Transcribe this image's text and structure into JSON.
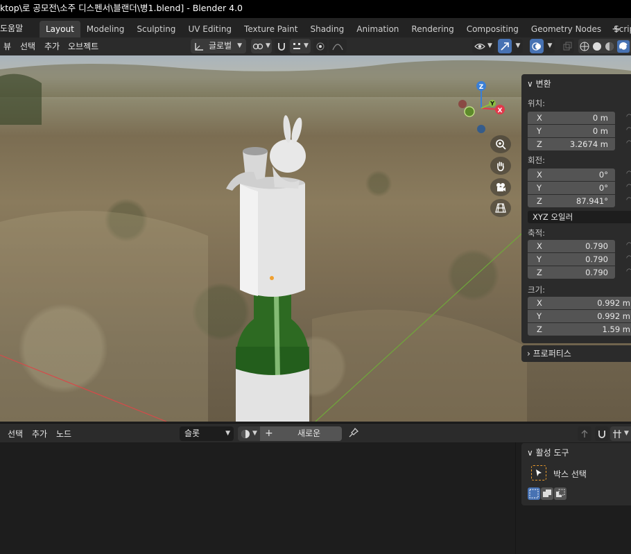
{
  "window": {
    "title": "ktop\\로 공모전\\소주 디스펜서\\블랜더\\병1.blend] - Blender 4.0"
  },
  "menu": {
    "help": "도움말"
  },
  "workspaces": [
    {
      "label": "Layout",
      "active": true
    },
    {
      "label": "Modeling"
    },
    {
      "label": "Sculpting"
    },
    {
      "label": "UV Editing"
    },
    {
      "label": "Texture Paint"
    },
    {
      "label": "Shading"
    },
    {
      "label": "Animation"
    },
    {
      "label": "Rendering"
    },
    {
      "label": "Compositing"
    },
    {
      "label": "Geometry Nodes"
    },
    {
      "label": "Scripting"
    }
  ],
  "workspace_add": "+",
  "viewport_header": {
    "view": "뷰",
    "select": "선택",
    "add": "추가",
    "object": "오브젝트",
    "transform_orientation": "글로벌"
  },
  "transform_panel": {
    "title": "변환",
    "location_label": "위치:",
    "location": {
      "x": "0 m",
      "y": "0 m",
      "z": "3.2674 m"
    },
    "rotation_label": "회전:",
    "rotation": {
      "x": "0°",
      "y": "0°",
      "z": "87.941°"
    },
    "rotation_mode": "XYZ 오일러",
    "scale_label": "축적:",
    "scale": {
      "x": "0.790",
      "y": "0.790",
      "z": "0.790"
    },
    "dimensions_label": "크기:",
    "dimensions": {
      "x": "0.992 m",
      "y": "0.992 m",
      "z": "1.59 m"
    },
    "axis_x": "X",
    "axis_y": "Y",
    "axis_z": "Z"
  },
  "properties_panel": {
    "title": "프로퍼티스"
  },
  "gizmo": {
    "x": "X",
    "y": "Y",
    "z": "Z"
  },
  "node_header": {
    "select": "선택",
    "add": "추가",
    "node": "노드",
    "slot": "슬롯",
    "new_button": "새로운",
    "plus": "+"
  },
  "active_tool": {
    "title": "활성 도구",
    "tool_name": "박스 선택"
  },
  "colors": {
    "accent": "#4772b3",
    "active_tool_border": "#e89a2c",
    "axis_x": "#e2384a",
    "axis_y": "#8cc13f",
    "axis_z": "#3a7fd6"
  }
}
